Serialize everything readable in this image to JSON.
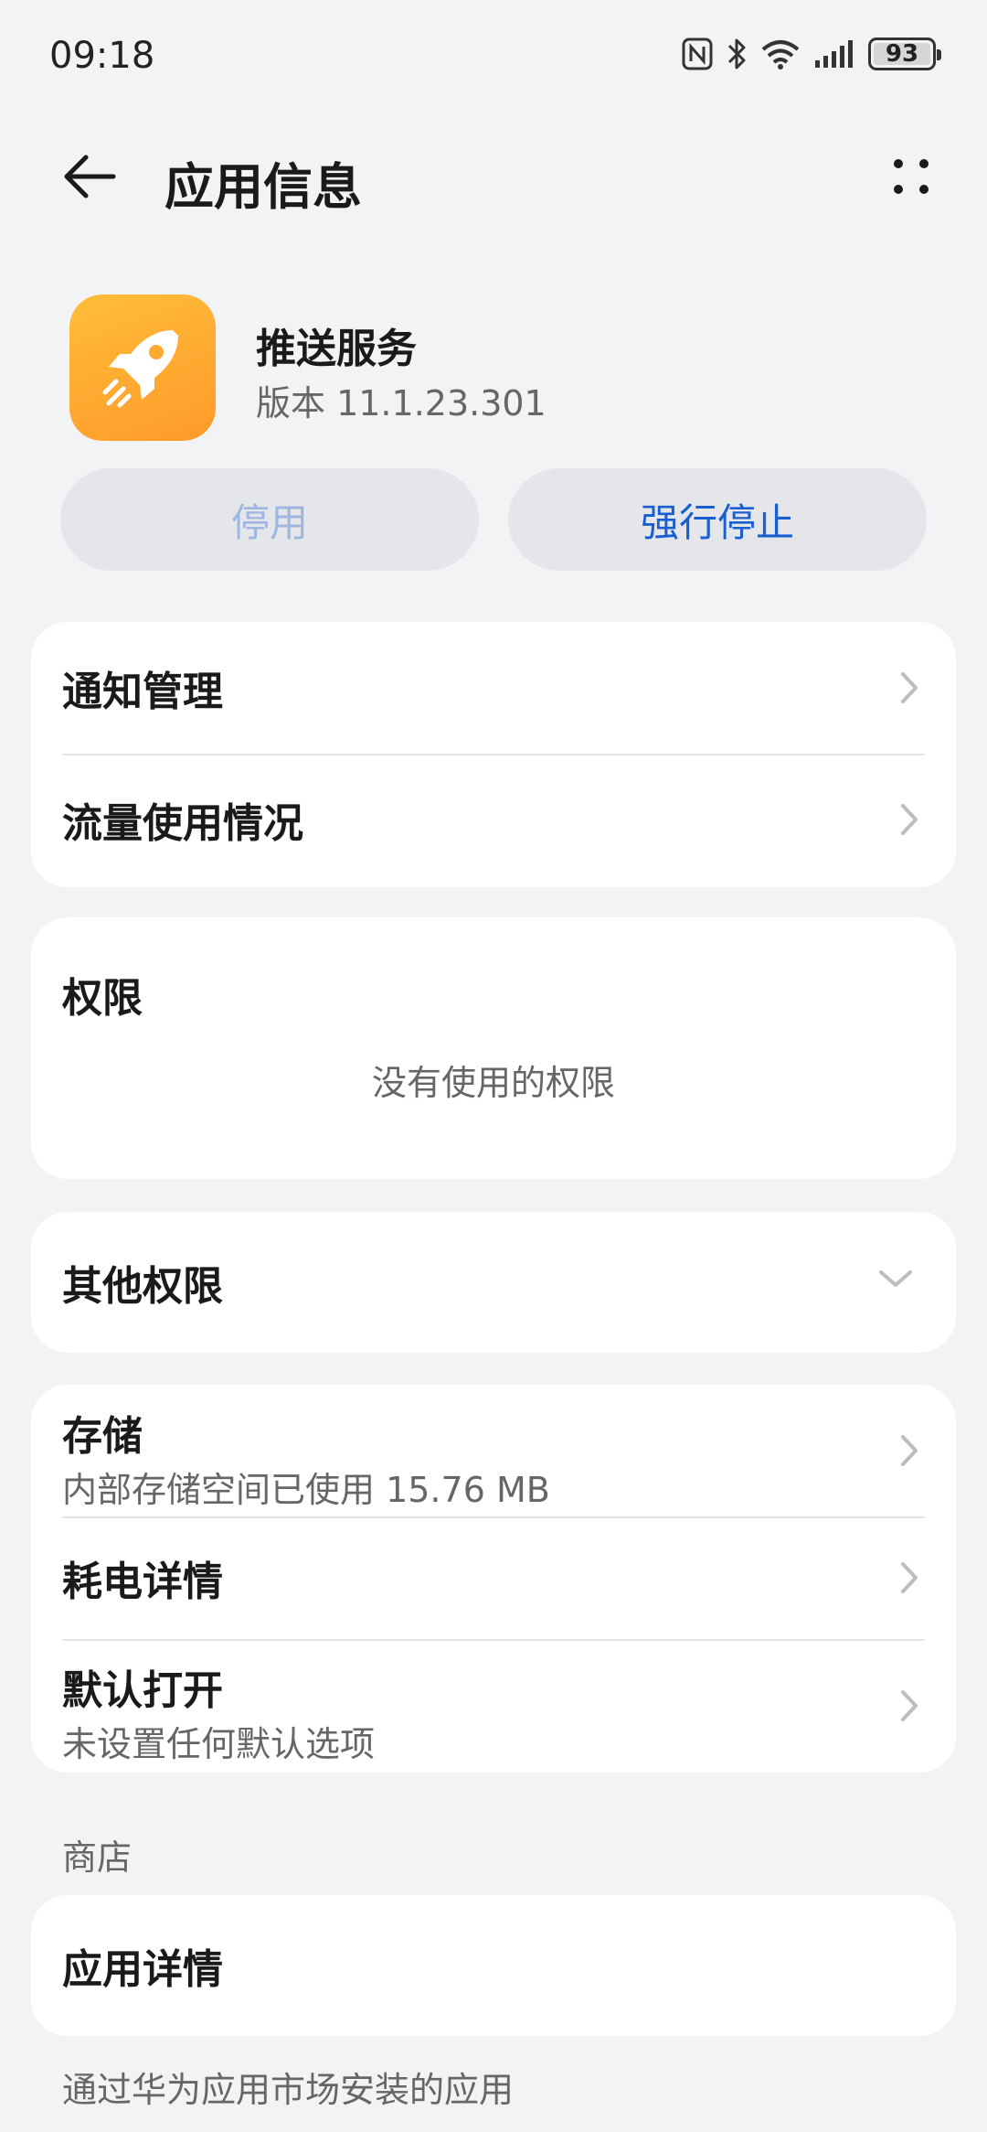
{
  "status_bar": {
    "time": "09:18",
    "battery_level": "93",
    "icons": [
      "nfc-icon",
      "bluetooth-icon",
      "wifi-icon",
      "signal-icon",
      "battery-icon"
    ]
  },
  "header": {
    "title": "应用信息"
  },
  "app": {
    "name": "推送服务",
    "version": "版本 11.1.23.301",
    "icon": "rocket-icon",
    "icon_color": "#ffa931"
  },
  "actions": {
    "disable_label": "停用",
    "force_stop_label": "强行停止"
  },
  "section1": {
    "items": [
      {
        "label": "通知管理"
      },
      {
        "label": "流量使用情况"
      }
    ]
  },
  "permissions": {
    "title": "权限",
    "empty_text": "没有使用的权限"
  },
  "other_permissions": {
    "label": "其他权限"
  },
  "section4": {
    "storage_label": "存储",
    "storage_sub": "内部存储空间已使用 15.76 MB",
    "battery_label": "耗电详情",
    "default_open_label": "默认打开",
    "default_open_sub": "未设置任何默认选项"
  },
  "store": {
    "section_label": "商店",
    "app_details_label": "应用详情",
    "footnote": "通过华为应用市场安装的应用"
  },
  "colors": {
    "accent": "#1a5fd1",
    "disabled_text": "#9fb7e0",
    "background": "#f1f3f5"
  }
}
